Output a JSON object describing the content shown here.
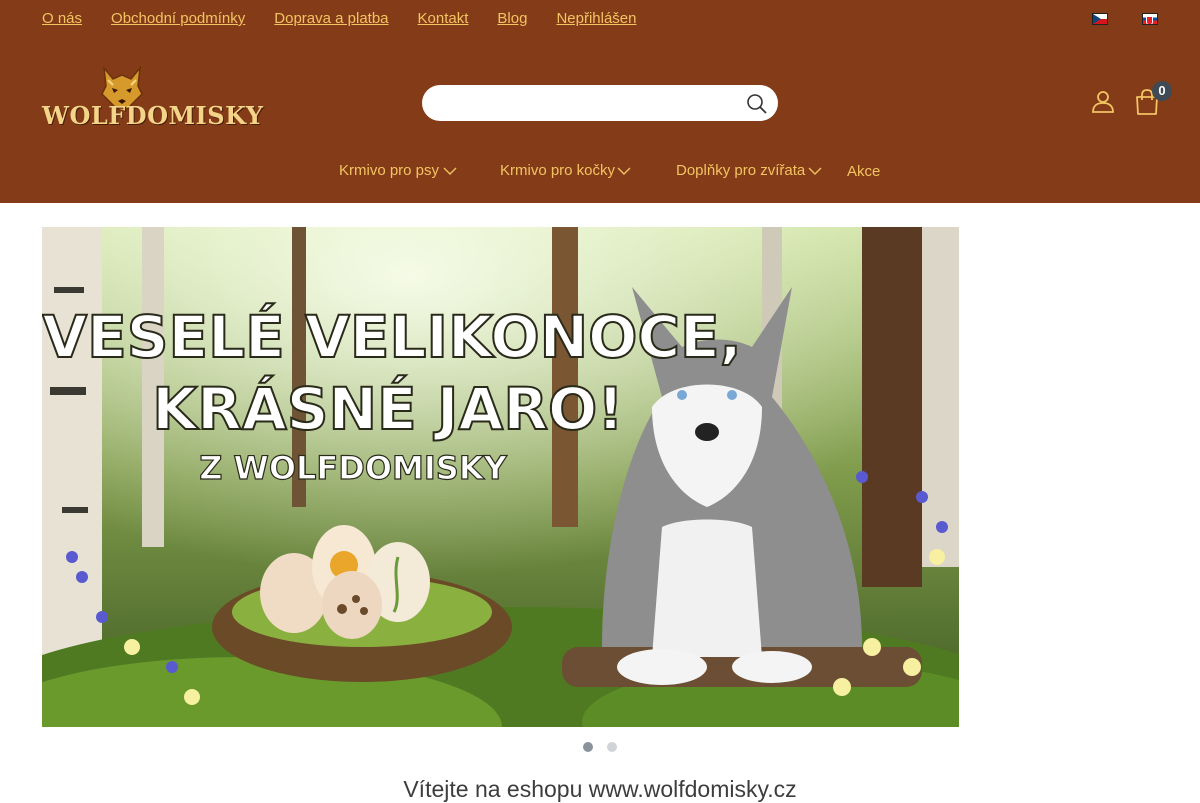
{
  "top_links": [
    "O nás",
    "Obchodní podmínky",
    "Doprava a platba",
    "Kontakt",
    "Blog",
    "Nepřihlášen"
  ],
  "languages": [
    {
      "code": "cs",
      "icon": "czech-flag-icon"
    },
    {
      "code": "sk",
      "icon": "slovak-flag-icon"
    }
  ],
  "logo": {
    "text": "WOLFDOMISKY",
    "icon": "wolf-head-icon"
  },
  "search": {
    "placeholder": "",
    "value": "",
    "icon": "search-icon"
  },
  "account": {
    "icon": "user-icon"
  },
  "cart": {
    "icon": "shopping-bag-icon",
    "count": "0"
  },
  "main_nav": [
    {
      "label": "Krmivo pro psy",
      "has_dropdown": true
    },
    {
      "label": "Krmivo pro kočky",
      "has_dropdown": true
    },
    {
      "label": "Doplňky pro zvířata",
      "has_dropdown": true
    },
    {
      "label": "Akce",
      "has_dropdown": false
    }
  ],
  "banner": {
    "line1": "VESELÉ VELIKONOCE,",
    "line2": "KRÁSNÉ JARO!",
    "line3": "Z WOLFDOMISKY"
  },
  "carousel": {
    "slides": 2,
    "active": 1
  },
  "welcome": "Vítejte na eshopu www.wolfdomisky.cz",
  "colors": {
    "header_bg": "#843b17",
    "link": "#f2c462",
    "badge": "#3f4a55"
  }
}
